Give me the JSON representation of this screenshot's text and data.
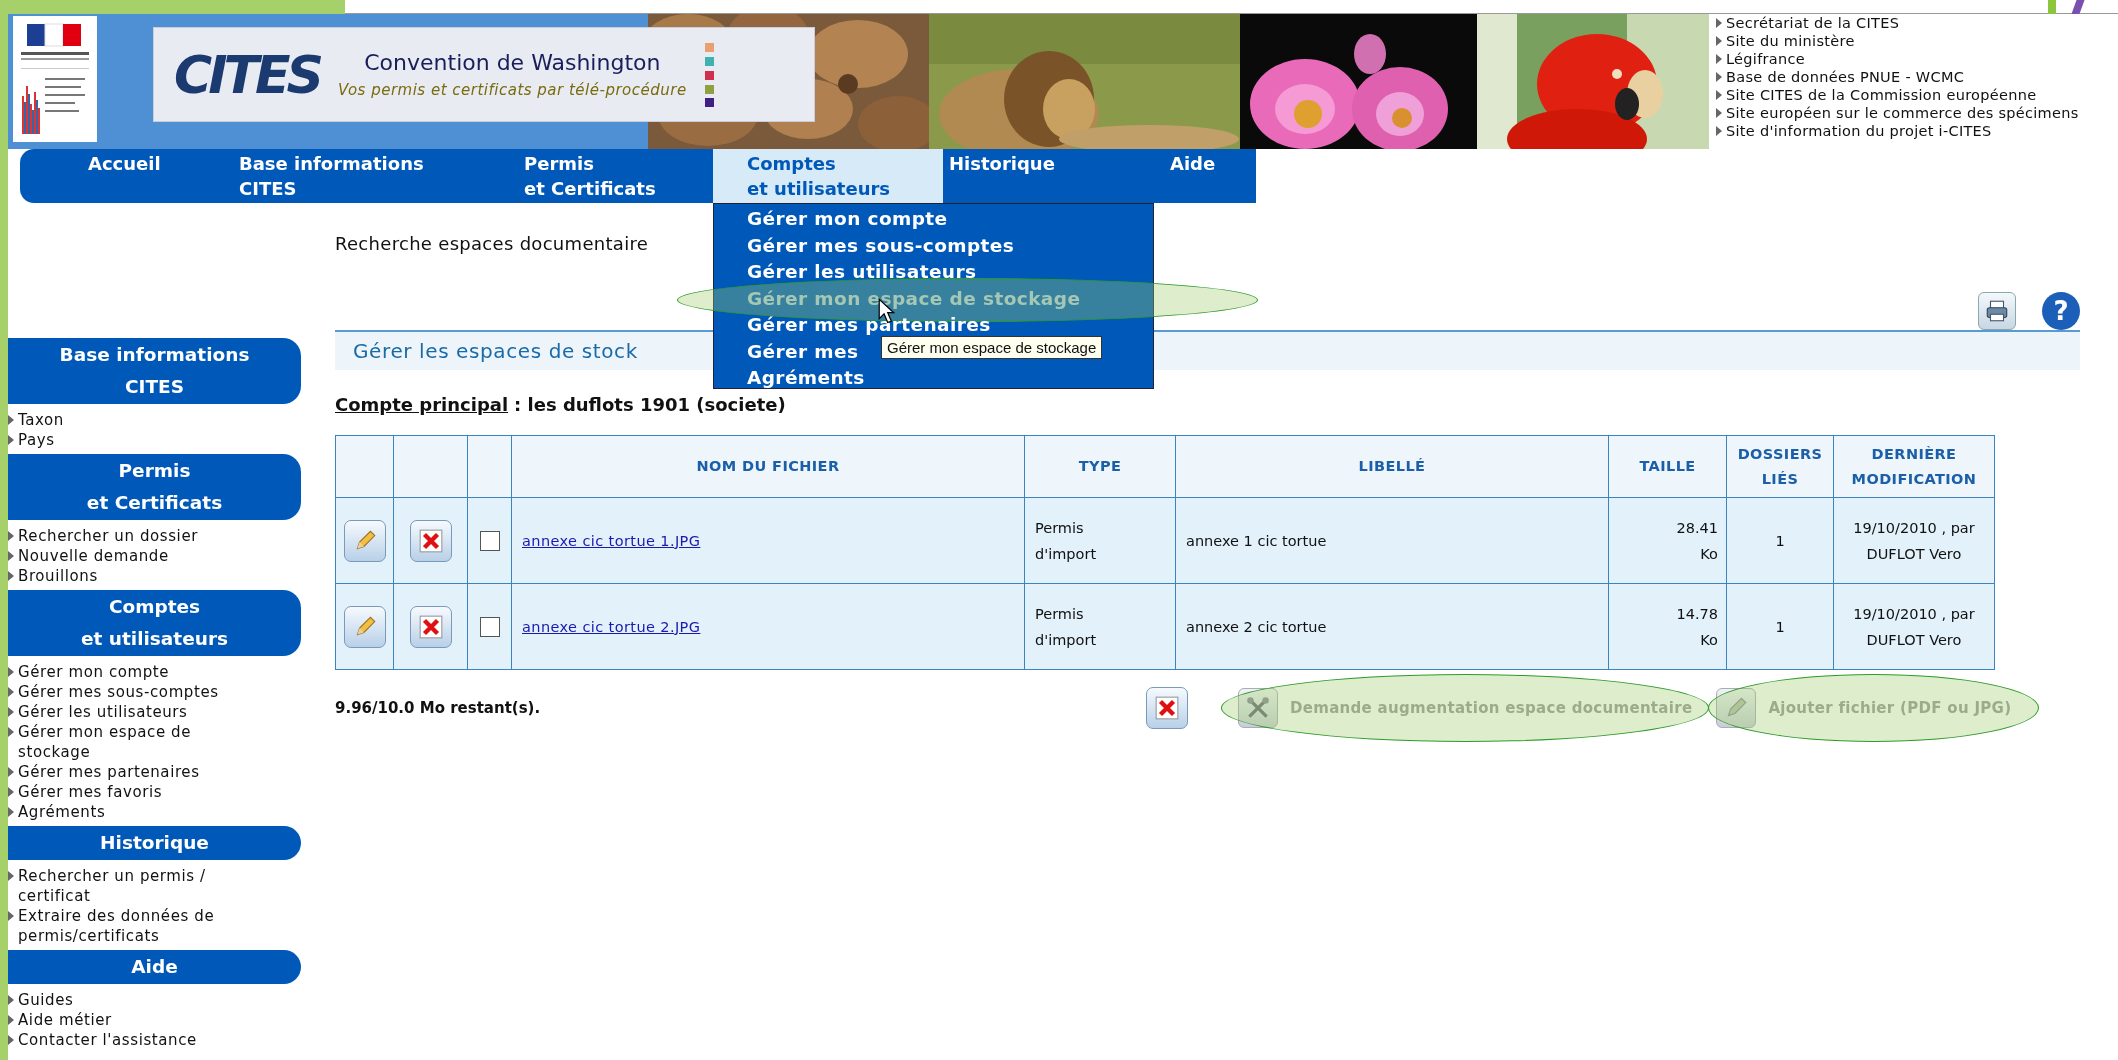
{
  "header": {
    "logo_text": "CITES",
    "banner_title": "Convention de Washington",
    "banner_subtitle": "Vos permis et certificats par télé-procédure",
    "links": [
      "Secrétariat de la CITES",
      "Site du ministère",
      "Légifrance",
      "Base de données PNUE - WCMC",
      "Site CITES de la Commission européenne",
      "Site européen sur le commerce des spécimens",
      "Site d'information du projet i-CITES"
    ]
  },
  "nav": {
    "tabs": [
      {
        "lines": [
          "Accueil"
        ],
        "selected": false
      },
      {
        "lines": [
          "Base informations",
          "CITES"
        ],
        "selected": false
      },
      {
        "lines": [
          "Permis",
          "et Certificats"
        ],
        "selected": false
      },
      {
        "lines": [
          "Comptes",
          "et utilisateurs"
        ],
        "selected": true
      },
      {
        "lines": [
          "Historique"
        ],
        "selected": false
      },
      {
        "lines": [
          "Aide"
        ],
        "selected": false
      }
    ]
  },
  "dropdown": {
    "items": [
      {
        "label": "Gérer mon compte",
        "highlighted": false
      },
      {
        "label": "Gérer mes sous-comptes",
        "highlighted": false
      },
      {
        "label": "Gérer les utilisateurs",
        "highlighted": false
      },
      {
        "label": "Gérer mon espace de stockage",
        "highlighted": true
      },
      {
        "label": "Gérer mes partenaires",
        "highlighted": false
      },
      {
        "label": "Gérer mes",
        "highlighted": false
      },
      {
        "label": "Agréments",
        "highlighted": false
      }
    ],
    "tooltip": "Gérer mon espace de stockage"
  },
  "sidebar": {
    "sections": [
      {
        "title_lines": [
          "Base informations",
          "CITES"
        ],
        "items": [
          "Taxon",
          "Pays"
        ]
      },
      {
        "title_lines": [
          "Permis",
          "et Certificats"
        ],
        "items": [
          "Rechercher un dossier",
          "Nouvelle demande",
          "Brouillons"
        ]
      },
      {
        "title_lines": [
          "Comptes",
          "et utilisateurs"
        ],
        "items": [
          "Gérer mon compte",
          "Gérer mes sous-comptes",
          "Gérer les utilisateurs",
          "Gérer mon espace de stockage",
          "Gérer mes partenaires",
          "Gérer mes favoris",
          "Agréments"
        ]
      },
      {
        "title_lines": [
          "Historique"
        ],
        "items": [
          "Rechercher un permis / certificat",
          "Extraire des données de permis/certificats"
        ]
      },
      {
        "title_lines": [
          "Aide"
        ],
        "items": [
          "Guides",
          "Aide métier",
          "Contacter l'assistance"
        ]
      }
    ]
  },
  "breadcrumb": "Recherche espaces documentaire",
  "help_glyph": "?",
  "page_title": "Gérer les espaces de stock",
  "account": {
    "label": "Compte principal",
    "value": ": les duflots 1901 (societe)"
  },
  "table": {
    "columns": [
      "NOM DU FICHIER",
      "TYPE",
      "LIBELLÉ",
      "TAILLE",
      "DOSSIERS LIÉS",
      "DERNIÈRE MODIFICATION"
    ],
    "rows": [
      {
        "file": "annexe cic tortue 1.JPG",
        "type": "Permis d'import",
        "label": "annexe 1 cic tortue",
        "size": "28.41 Ko",
        "linked": "1",
        "modified": "19/10/2010 , par DUFLOT Vero",
        "checked": false
      },
      {
        "file": "annexe cic tortue 2.JPG",
        "type": "Permis d'import",
        "label": "annexe 2 cic tortue",
        "size": "14.78 Ko",
        "linked": "1",
        "modified": "19/10/2010 , par DUFLOT Vero",
        "checked": false
      }
    ]
  },
  "quota": "9.96/10.0 Mo restant(s).",
  "actions": [
    {
      "kind": "delete",
      "disabled": false,
      "highlighted": false
    },
    {
      "kind": "request",
      "label": "Demande augmentation espace documentaire",
      "disabled": true,
      "highlighted": true
    },
    {
      "kind": "add",
      "label": "Ajouter fichier (PDF ou JPG)",
      "disabled": true,
      "highlighted": true
    }
  ]
}
